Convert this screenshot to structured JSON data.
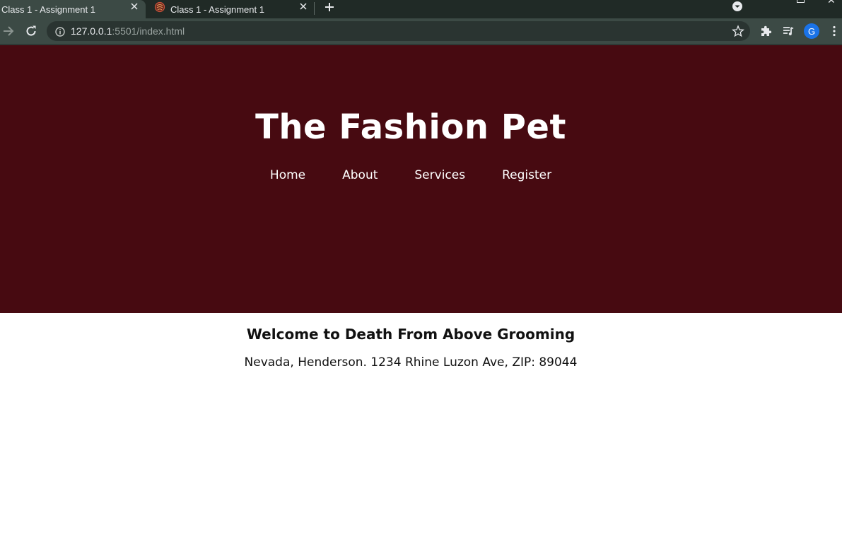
{
  "browser": {
    "tabs": [
      {
        "title": "Class 1 - Assignment 1",
        "active": true
      },
      {
        "title": "Class 1 - Assignment 1",
        "active": false
      }
    ],
    "url_host": "127.0.0.1",
    "url_rest": ":5501/index.html",
    "profile_initial": "G",
    "colors": {
      "tabbar": "#202a26",
      "toolbar": "#3c4a45",
      "profile": "#1a73e8"
    },
    "icons": [
      "close-icon",
      "favicon-icon",
      "plus-icon",
      "tab-search-icon",
      "back-arrow-icon",
      "reload-icon",
      "info-icon",
      "star-icon",
      "puzzle-icon",
      "media-queue-icon",
      "kebab-menu-icon"
    ]
  },
  "page": {
    "title": "The Fashion Pet",
    "nav": [
      "Home",
      "About",
      "Services",
      "Register"
    ],
    "welcome": "Welcome to Death From Above Grooming",
    "address": "Nevada, Henderson. 1234 Rhine Luzon Ave, ZIP: 89044",
    "colors": {
      "hero_background": "#470a11",
      "hero_text": "#ffffff",
      "body_text": "#111111"
    }
  }
}
